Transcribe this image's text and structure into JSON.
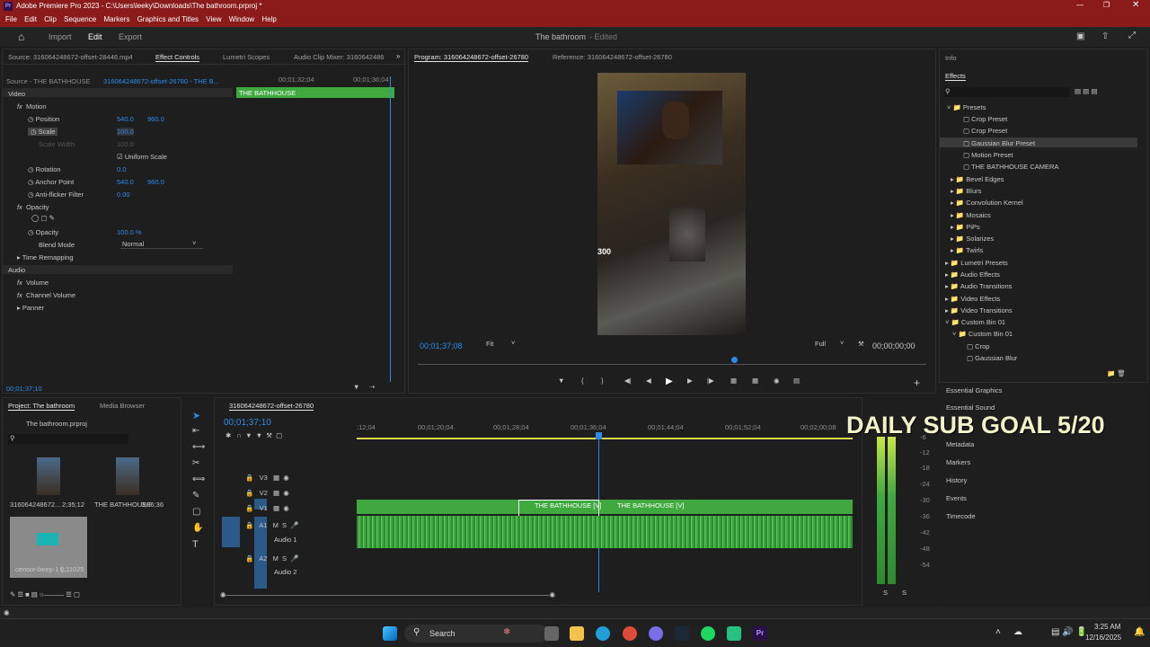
{
  "title": "Adobe Premiere Pro 2023 - C:\\Users\\leeky\\Downloads\\The bathroom.prproj *",
  "menu": [
    "File",
    "Edit",
    "Clip",
    "Sequence",
    "Markers",
    "Graphics and Titles",
    "View",
    "Window",
    "Help"
  ],
  "workspace": {
    "import": "Import",
    "edit": "Edit",
    "export": "Export",
    "project_title": "The bathroom",
    "edited": "- Edited"
  },
  "ec": {
    "source": "Source: 316064248672-offset-28446.mp4",
    "tab_effect": "Effect Controls",
    "tab_lumetri": "Lumetri Scopes",
    "tab_audio": "Audio Clip Mixer: 3160642486",
    "master": "Source - THE BATHHOUSE",
    "clip": "316064248672-offset-26780 - THE B...",
    "time_mid": "00;01;32;04",
    "time_end": "00;01;36;04",
    "clip_label": "THE BATHHOUSE",
    "video": "Video",
    "motion": "Motion",
    "position": "Position",
    "pos_x": "540.0",
    "pos_y": "960.0",
    "scale": "Scale",
    "scale_val": "100.0",
    "scale_width": "Scale Width",
    "scale_width_val": "100.0",
    "uniform": "Uniform Scale",
    "rotation": "Rotation",
    "rot_val": "0.0",
    "anchor": "Anchor Point",
    "anc_x": "540.0",
    "anc_y": "960.0",
    "antiflicker": "Anti-flicker Filter",
    "af_val": "0.00",
    "opacity_grp": "Opacity",
    "opacity": "Opacity",
    "opacity_val": "100.0 %",
    "blend": "Blend Mode",
    "blend_val": "Normal",
    "time_remap": "Time Remapping",
    "audio": "Audio",
    "volume": "Volume",
    "channel_volume": "Channel Volume",
    "panner": "Panner",
    "timecode": "00;01;37;10"
  },
  "program": {
    "tab": "Program: 316064248672-offset-26780",
    "reference": "Reference: 316064248672-offset-26780",
    "timecode": "00;01;37;08",
    "fit": "Fit",
    "quality": "Full",
    "duration": "00;00;00;00",
    "overlay": "300"
  },
  "effects": {
    "info": "Info",
    "title": "Effects",
    "presets": "Presets",
    "items": [
      "Crop Preset",
      "Crop Preset",
      "Gaussian Blur Preset",
      "Motion Preset",
      "THE BATHHOUSE CAMERA"
    ],
    "folders": [
      "Bevel Edges",
      "Blurs",
      "Convolution Kernel",
      "Mosaics",
      "PiPs",
      "Solarizes",
      "Twirls"
    ],
    "top": [
      "Lumetri Presets",
      "Audio Effects",
      "Audio Transitions",
      "Video Effects",
      "Video Transitions",
      "Custom Bin 01"
    ],
    "custom_bin": "Custom Bin 01",
    "custom_items": [
      "Crop",
      "Gaussian Blur"
    ],
    "lower": [
      "Essential Graphics",
      "Essential Sound",
      "Metadata",
      "Markers",
      "History",
      "Events",
      "Timecode"
    ]
  },
  "project": {
    "tab": "Project: The bathroom",
    "media": "Media Browser",
    "file": "The bathroom.prproj",
    "items": [
      {
        "name": "316064248672...",
        "dur": "2;35;12"
      },
      {
        "name": "THE BATHHOUSE",
        "dur": "3;06;36"
      },
      {
        "name": "censor-beep-1 (...",
        "dur": "0;11025"
      }
    ]
  },
  "timeline": {
    "seq": "316064248672-offset-26780",
    "timecode": "00;01;37;10",
    "ticks": [
      ":12;04",
      "00;01;20;04",
      "00;01;28;04",
      "00;01;36;04",
      "00;01;44;04",
      "00;01;52;04",
      "00;02;00;08"
    ],
    "tracks": [
      "V3",
      "V2",
      "V1",
      "A1",
      "A2"
    ],
    "audio1": "Audio 1",
    "audio2": "Audio 2",
    "clip1": "THE BATHHOUSE [V]",
    "clip2": "THE BATHHOUSE [V]"
  },
  "meter": {
    "labels": [
      "-6",
      "-12",
      "-18",
      "-24",
      "-30",
      "-36",
      "-42",
      "-48",
      "-54"
    ],
    "solo": "S"
  },
  "overlay": "DAILY SUB GOAL 5/20",
  "taskbar": {
    "search": "Search",
    "time": "3:25 AM",
    "date": "12/16/2025"
  }
}
